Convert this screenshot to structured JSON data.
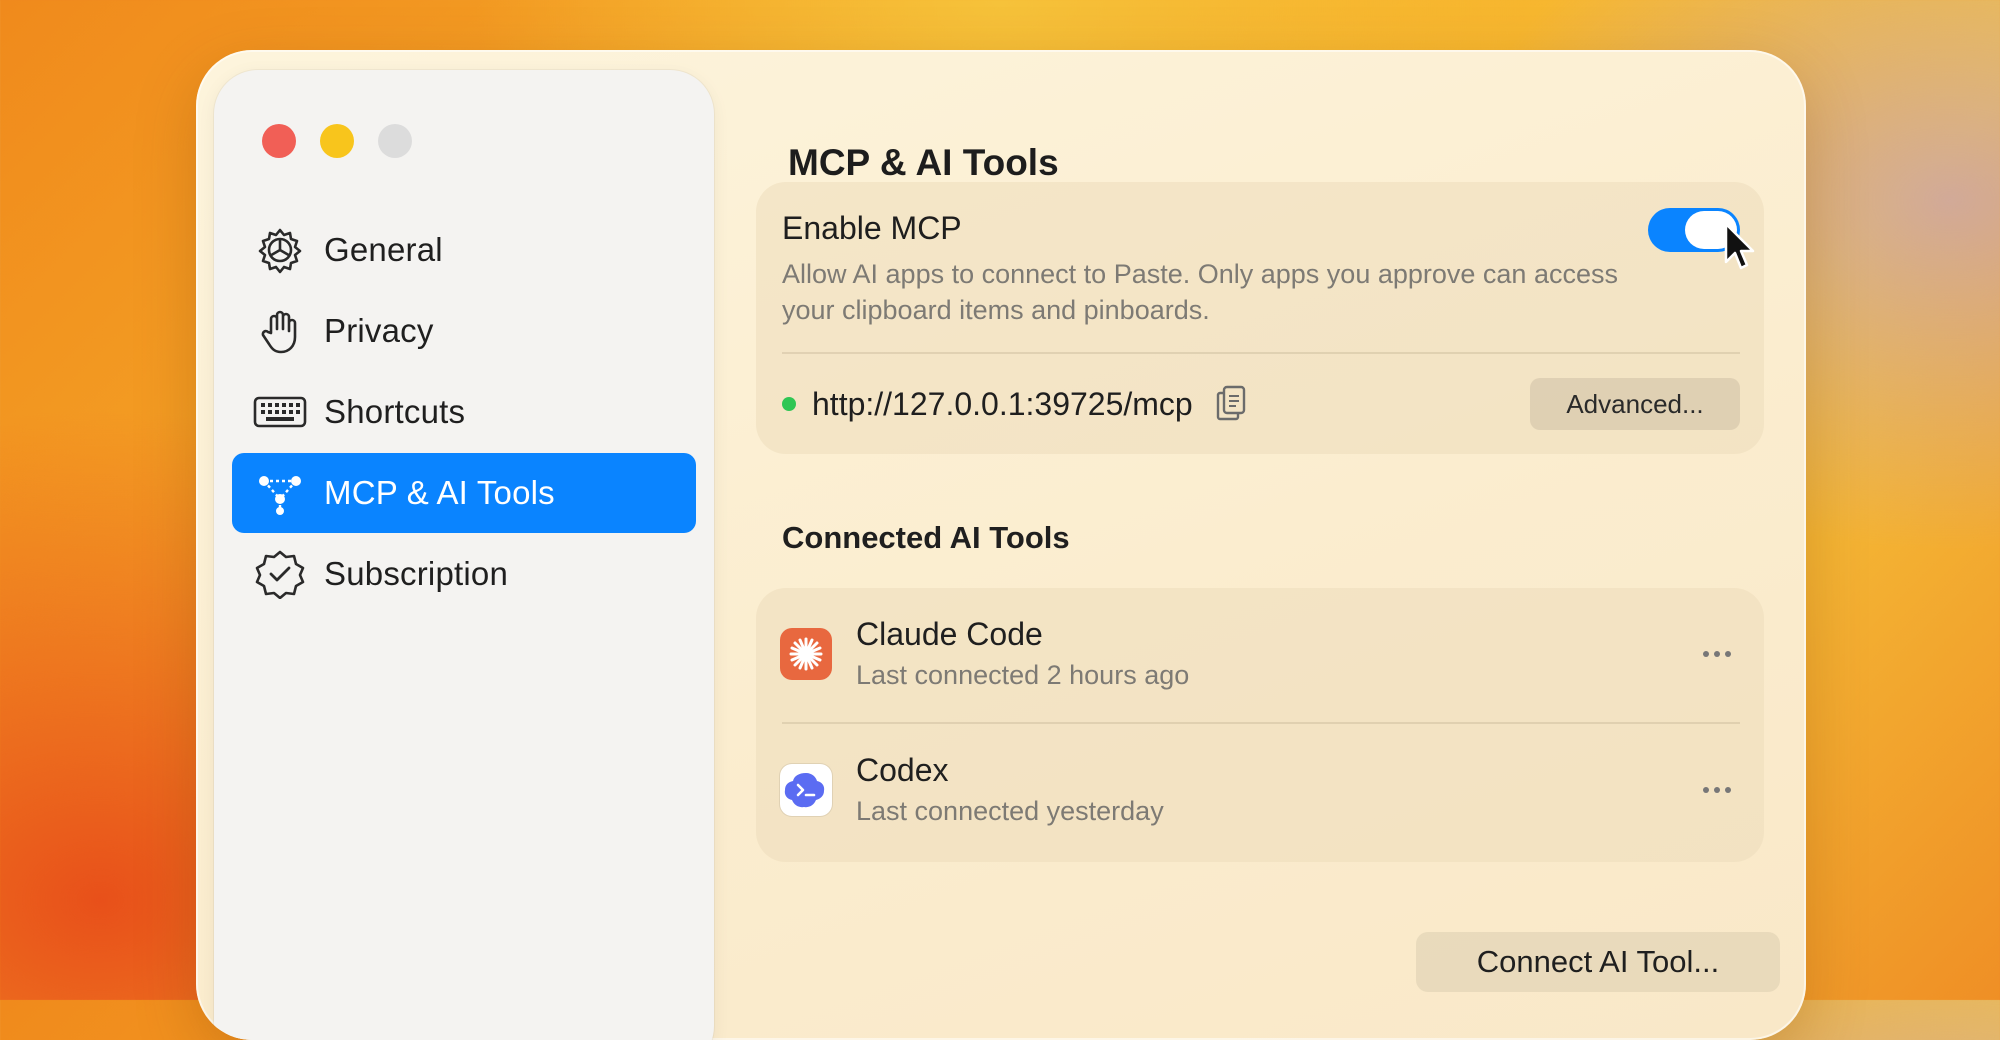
{
  "window": {
    "traffic_lights": [
      "close",
      "minimize",
      "zoom"
    ]
  },
  "sidebar": {
    "items": [
      {
        "label": "General",
        "icon": "gear-icon",
        "active": false
      },
      {
        "label": "Privacy",
        "icon": "hand-icon",
        "active": false
      },
      {
        "label": "Shortcuts",
        "icon": "keyboard-icon",
        "active": false
      },
      {
        "label": "MCP & AI Tools",
        "icon": "mcp-network-icon",
        "active": true
      },
      {
        "label": "Subscription",
        "icon": "badge-check-icon",
        "active": false
      }
    ]
  },
  "main": {
    "title": "MCP & AI Tools",
    "mcp": {
      "enable_label": "Enable MCP",
      "description": "Allow AI apps to connect to Paste. Only apps you approve can access your clipboard items and pinboards.",
      "enabled": true,
      "url": "http://127.0.0.1:39725/mcp",
      "status": "online",
      "advanced_label": "Advanced..."
    },
    "connected_title": "Connected AI Tools",
    "tools": [
      {
        "name": "Claude Code",
        "last": "Last connected 2 hours ago",
        "icon": "claude-icon"
      },
      {
        "name": "Codex",
        "last": "Last connected yesterday",
        "icon": "codex-icon"
      }
    ],
    "connect_label": "Connect AI Tool..."
  },
  "colors": {
    "accent": "#0a84ff",
    "status_green": "#2fc654",
    "claude_orange": "#e8683f"
  }
}
